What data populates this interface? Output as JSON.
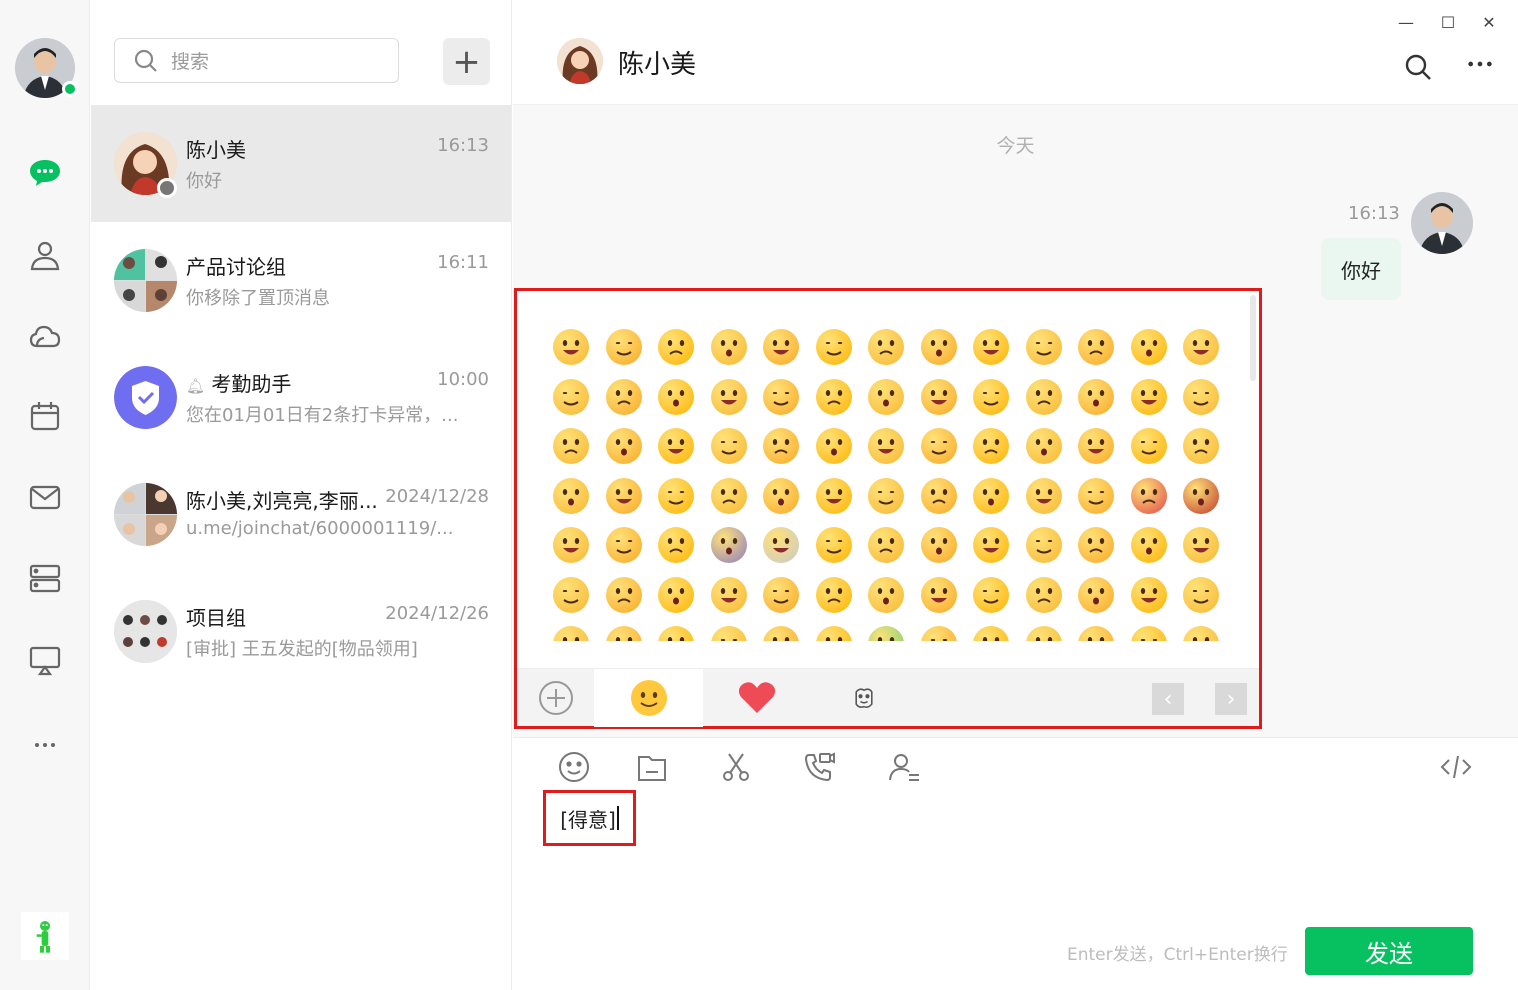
{
  "sidebar": {
    "user_status": "online",
    "nav": [
      "chat-icon",
      "contacts-icon",
      "cloud-icon",
      "calendar-icon",
      "mail-icon",
      "storage-icon",
      "screen-share-icon",
      "more-icon"
    ]
  },
  "search": {
    "placeholder": "搜索"
  },
  "add_button": "+",
  "conversations": [
    {
      "name": "陈小美",
      "time": "16:13",
      "preview": "你好"
    },
    {
      "name": "产品讨论组",
      "time": "16:11",
      "preview": "你移除了置顶消息"
    },
    {
      "name": "考勤助手",
      "time": "10:00",
      "preview": "您在01月01日有2条打卡异常，..."
    },
    {
      "name": "陈小美,刘亮亮,李丽...",
      "time": "2024/12/28",
      "preview": "u.me/joinchat/6000001119/..."
    },
    {
      "name": "项目组",
      "time": "2024/12/26",
      "preview": "[审批] 王五发起的[物品领用]"
    }
  ],
  "chat": {
    "title": "陈小美",
    "date_separator": "今天",
    "message": {
      "time": "16:13",
      "text": "你好"
    }
  },
  "window_controls": {
    "minimize": "—",
    "maximize": "☐",
    "close": "✕"
  },
  "emoji_panel": {
    "tabs": [
      "add-emoji-icon",
      "smiley-icon",
      "heart-icon",
      "sticker-icon"
    ],
    "emoji_colors": [
      "#f7b731",
      "#f9a825",
      "#ffb300",
      "#e04848",
      "#8e7cc3",
      "#c9c9c9",
      "#6fcf73"
    ]
  },
  "composer": {
    "input_text": "[得意]",
    "hint": "Enter发送，Ctrl+Enter换行",
    "send_label": "发送"
  }
}
